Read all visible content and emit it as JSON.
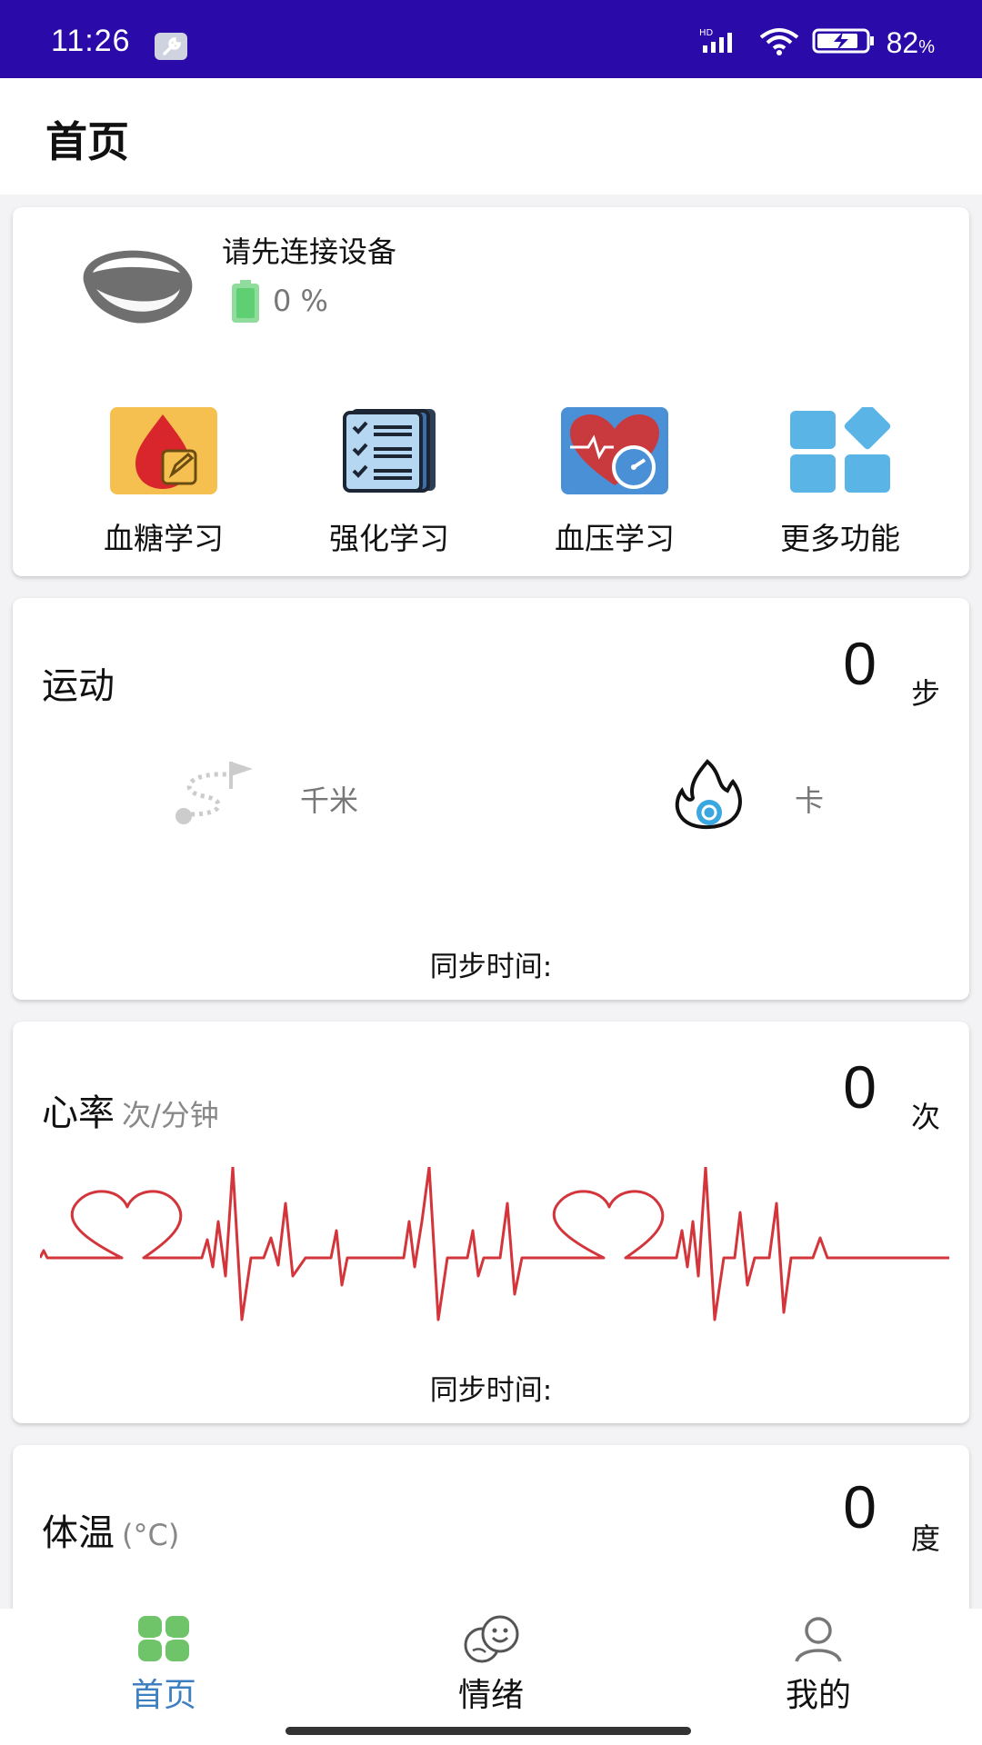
{
  "status_bar": {
    "time": "11:26",
    "network": "HD",
    "battery": "82",
    "battery_unit": "%"
  },
  "header": {
    "title": "首页"
  },
  "device": {
    "status": "请先连接设备",
    "battery": "0 %"
  },
  "functions": [
    {
      "label": "血糖学习",
      "icon": "blood-drop-edit-icon"
    },
    {
      "label": "强化学习",
      "icon": "checklist-docs-icon"
    },
    {
      "label": "血压学习",
      "icon": "heart-gauge-icon"
    },
    {
      "label": "更多功能",
      "icon": "grid-apps-icon"
    }
  ],
  "sport": {
    "title": "运动",
    "value": "0",
    "unit": "步",
    "distance_unit": "千米",
    "calorie_unit": "卡",
    "sync_label": "同步时间:"
  },
  "heart_rate": {
    "title": "心率",
    "subunit": "次/分钟",
    "value": "0",
    "unit": "次",
    "sync_label": "同步时间:"
  },
  "temperature": {
    "title": "体温",
    "subunit": "(°C)",
    "value": "0",
    "unit": "度"
  },
  "bottom_nav": [
    {
      "label": "首页",
      "active": true
    },
    {
      "label": "情绪",
      "active": false
    },
    {
      "label": "我的",
      "active": false
    }
  ],
  "colors": {
    "status_bar": "#2a0aa8",
    "active_tab": "#3d7fc0",
    "heart_line": "#d3353b",
    "icon_green": "#6fc46a"
  }
}
